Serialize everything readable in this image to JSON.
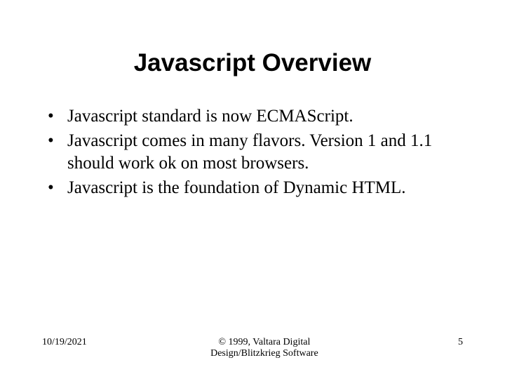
{
  "title": "Javascript Overview",
  "bullets": [
    "Javascript standard is now ECMAScript.",
    "Javascript comes in many flavors. Version 1 and 1.1 should work ok on most browsers.",
    "Javascript is the foundation of Dynamic HTML."
  ],
  "footer": {
    "date": "10/19/2021",
    "copyright": "© 1999, Valtara Digital\nDesign/Blitzkrieg Software",
    "page": "5"
  }
}
